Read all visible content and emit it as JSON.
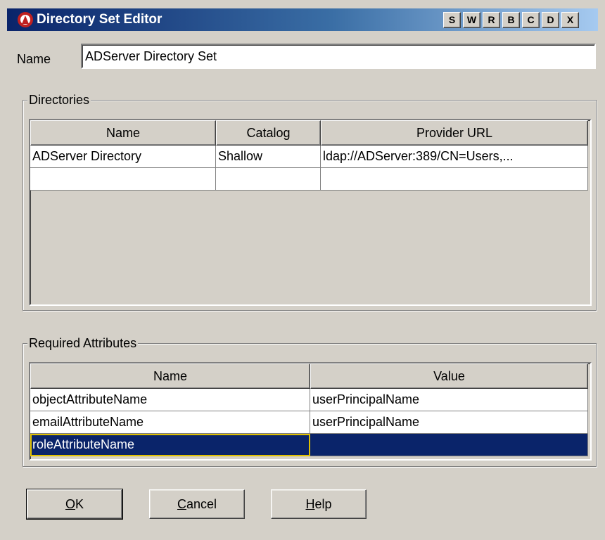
{
  "window": {
    "title": "Directory Set Editor",
    "title_buttons": [
      "S",
      "W",
      "R",
      "B",
      "C",
      "D",
      "X"
    ]
  },
  "name_field": {
    "label": "Name",
    "value": "ADServer Directory Set"
  },
  "directories": {
    "legend": "Directories",
    "columns": [
      "Name",
      "Catalog",
      "Provider URL"
    ],
    "rows": [
      [
        "ADServer Directory",
        "Shallow",
        "ldap://ADServer:389/CN=Users,..."
      ],
      [
        "",
        "",
        ""
      ]
    ]
  },
  "required_attributes": {
    "legend": "Required Attributes",
    "columns": [
      "Name",
      "Value"
    ],
    "rows": [
      [
        "objectAttributeName",
        "userPrincipalName"
      ],
      [
        "emailAttributeName",
        "userPrincipalName"
      ],
      [
        "roleAttributeName",
        ""
      ]
    ],
    "selected_row_index": 2
  },
  "buttons": {
    "ok": {
      "mnemonic": "O",
      "rest": "K"
    },
    "cancel": {
      "mnemonic": "C",
      "rest": "ancel"
    },
    "help": {
      "mnemonic": "H",
      "rest": "elp"
    }
  },
  "colors": {
    "selection": "#0a246a",
    "focus_outline": "#e0c000",
    "window_bg": "#d4d0c8"
  }
}
